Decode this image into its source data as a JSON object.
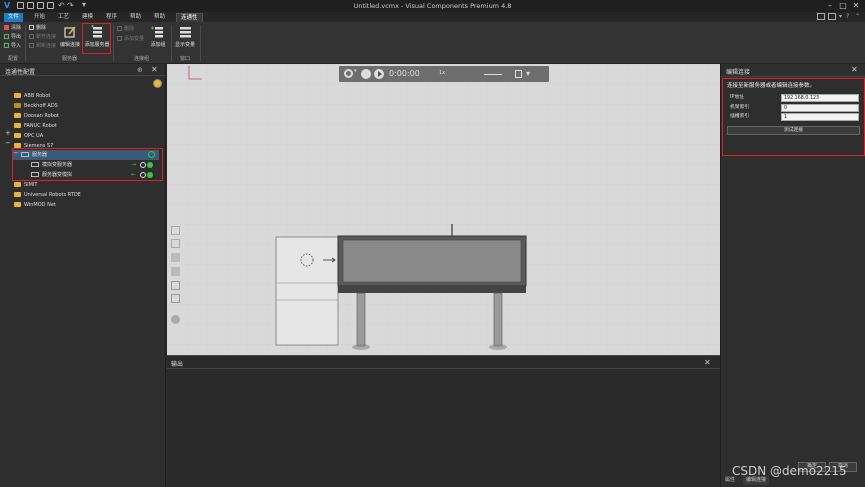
{
  "window": {
    "title": "Untitled.vcmx - Visual Components Premium 4.8",
    "minimize": "–",
    "maximize": "□",
    "close": "✕"
  },
  "tabs": [
    {
      "label": "文件"
    },
    {
      "label": "开始"
    },
    {
      "label": "工艺"
    },
    {
      "label": "建模"
    },
    {
      "label": "程序"
    },
    {
      "label": "帮助"
    },
    {
      "label": "帮助"
    },
    {
      "label": "连通性"
    }
  ],
  "ribbon": {
    "small_left": [
      {
        "label": "清除"
      },
      {
        "label": "导出"
      },
      {
        "label": "导入"
      }
    ],
    "small_mid": [
      {
        "label": "删除"
      },
      {
        "label": "断开连接"
      },
      {
        "label": "刷新连接"
      }
    ],
    "edit_connection": "编辑连接",
    "add_server": "添加服务器",
    "small_right": [
      {
        "label": "删除"
      },
      {
        "label": "添加变量"
      }
    ],
    "add_group": "添加组",
    "show_variables": "显示变量",
    "group_labels": {
      "config": "配置",
      "server": "服务器",
      "connect": "连接组",
      "window": "窗口"
    }
  },
  "left_panel": {
    "title": "连通性配置",
    "pin": "⊕",
    "close": "✕",
    "items": [
      {
        "label": "ABB Robot"
      },
      {
        "label": "Beckhoff ADS"
      },
      {
        "label": "Doosan Robot"
      },
      {
        "label": "FANUC Robot"
      },
      {
        "label": "OPC UA"
      },
      {
        "label": "Siemens S7"
      },
      {
        "label": "服务器"
      },
      {
        "label": "模拟变服务器"
      },
      {
        "label": "服务器变模拟"
      },
      {
        "label": "SIMIT"
      },
      {
        "label": "Universal Robots RTDE"
      },
      {
        "label": "WinMOD Net"
      }
    ]
  },
  "viewport": {
    "time": "0:00:00",
    "speed": "1x"
  },
  "output": {
    "title": "输出",
    "close": "✕"
  },
  "right_panel": {
    "title": "编辑连接",
    "close": "✕",
    "description": "连接至新服务器或者编辑连接参数。",
    "fields": [
      {
        "label": "IP地址",
        "value": "192.168.0.123"
      },
      {
        "label": "机架索引",
        "value": "0"
      },
      {
        "label": "插槽索引",
        "value": "1"
      }
    ],
    "test_button": "测试连接",
    "ok_button": "确定",
    "cancel_button": "取消"
  },
  "bottom_tabs": [
    {
      "label": "属性"
    },
    {
      "label": "编辑连接"
    }
  ],
  "watermark": "CSDN @demo2215",
  "colors": {
    "accent": "#1e7dc8",
    "highlight": "#e02020",
    "folder": "#e9b53b",
    "status_green": "#3cc43c"
  }
}
